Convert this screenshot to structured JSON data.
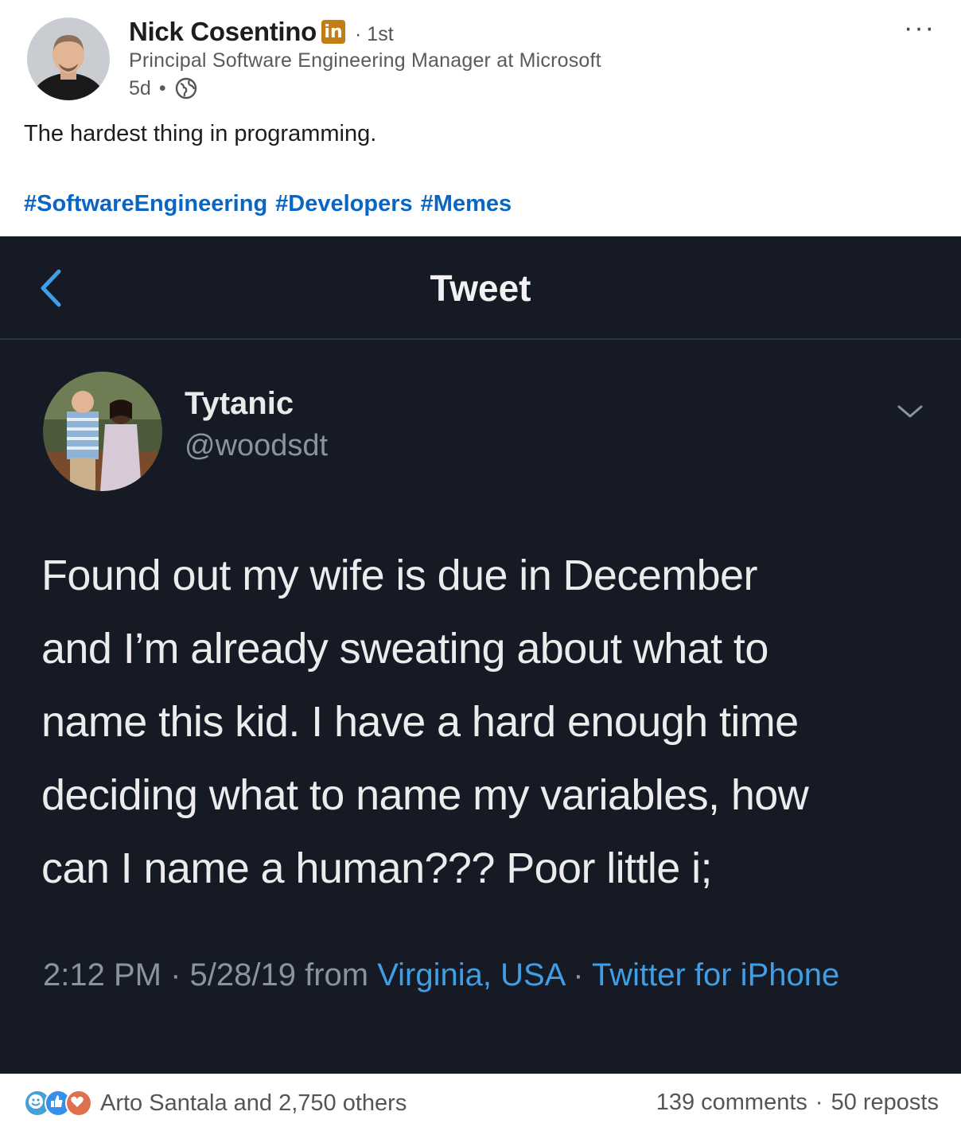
{
  "author": {
    "name": "Nick Cosentino",
    "badge_text": "in",
    "degree": "· 1st",
    "headline": "Principal Software Engineering Manager at Microsoft",
    "time_ago": "5d",
    "meta_separator": "•",
    "visibility_icon": "globe-icon"
  },
  "more_menu": "···",
  "post": {
    "text": "The hardest thing in programming.",
    "hashtags": [
      "#SoftwareEngineering",
      "#Developers",
      "#Memes"
    ]
  },
  "tweet": {
    "nav_title": "Tweet",
    "display_name": "Tytanic",
    "handle": "@woodsdt",
    "body_lines": [
      "Found out my wife is due in December",
      "and I’m already sweating about what to",
      "name this kid.  I have a hard enough time",
      "deciding what to name my variables, how",
      "can I name a human??? Poor little i;"
    ],
    "time": "2:12 PM · 5/28/19 from ",
    "location": "Virginia, USA",
    "dot": " · ",
    "source": "Twitter for iPhone"
  },
  "social": {
    "reactions_text": "Arto Santala and 2,750 others",
    "comments": "139 comments",
    "separator": "·",
    "reposts": "50 reposts"
  },
  "colors": {
    "link": "#0a66c2",
    "tweet_bg": "#161a24",
    "tweet_link": "#3e9ee6",
    "linkedin_gold": "#c37d16"
  }
}
